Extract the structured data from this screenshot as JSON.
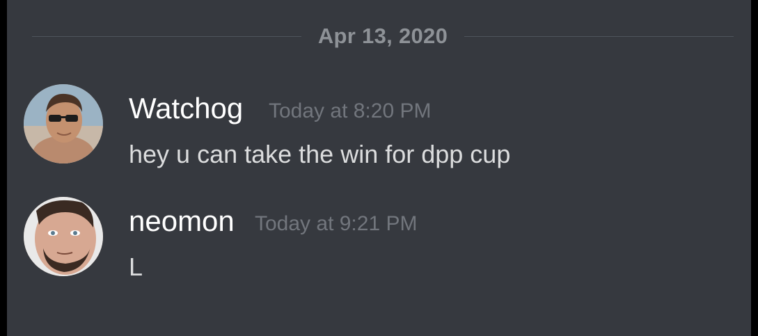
{
  "divider": {
    "date": "Apr 13, 2020"
  },
  "messages": [
    {
      "username": "Watchog",
      "timestamp": "Today at 8:20 PM",
      "content": "hey u can take the win for dpp cup",
      "avatar_icon": "avatar-photo"
    },
    {
      "username": "neomon",
      "timestamp": "Today at 9:21 PM",
      "content": "L",
      "avatar_icon": "avatar-photo"
    }
  ],
  "colors": {
    "background": "#36393f",
    "username": "#ffffff",
    "timestamp": "#72767d",
    "message_text": "#dcddde",
    "divider_text": "#8e9297",
    "divider_line": "#4f545c"
  }
}
